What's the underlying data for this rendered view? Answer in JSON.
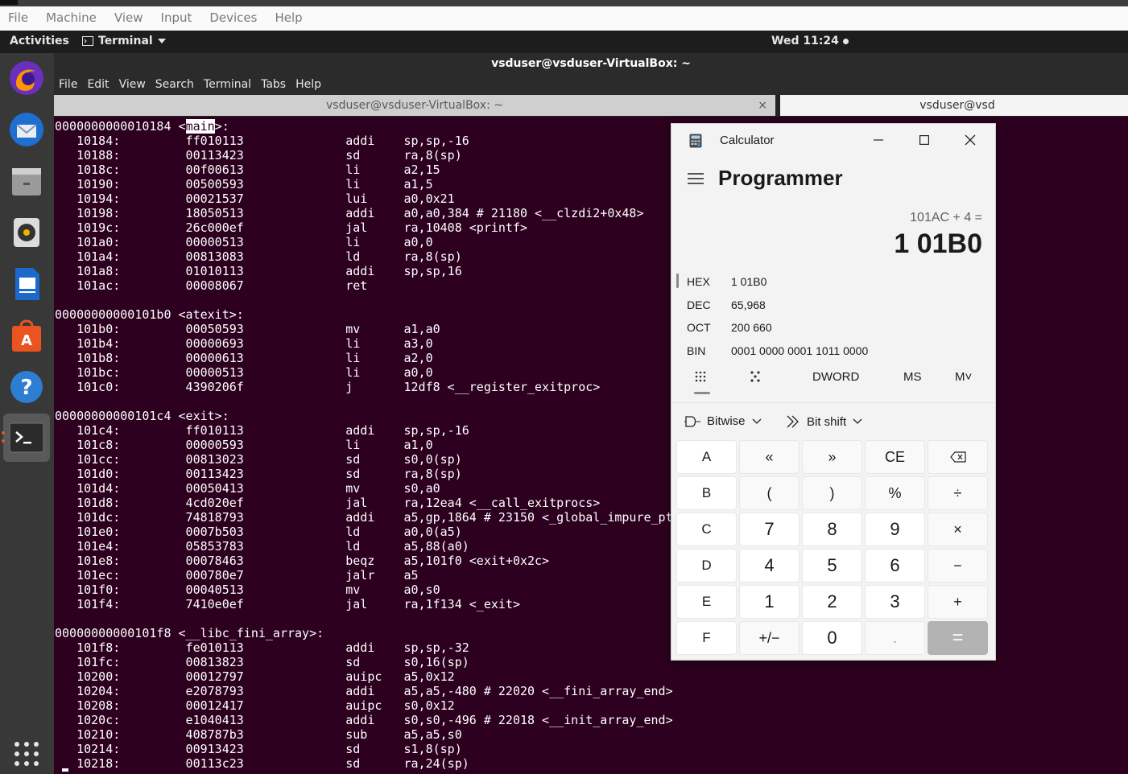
{
  "vbox_menu": [
    "File",
    "Machine",
    "View",
    "Input",
    "Devices",
    "Help"
  ],
  "topbar": {
    "activities": "Activities",
    "app_name": "Terminal",
    "clock": "Wed 11:24"
  },
  "terminal": {
    "window_title": "vsduser@vsduser-VirtualBox: ~",
    "menu": [
      "File",
      "Edit",
      "View",
      "Search",
      "Terminal",
      "Tabs",
      "Help"
    ],
    "tabs": [
      {
        "label": "vsduser@vsduser-VirtualBox: ~",
        "close": "×"
      },
      {
        "label": "vsduser@vsd"
      }
    ],
    "lines": [
      {
        "pre": "0000000000010184 <",
        "hl": "main",
        "post": ">:"
      },
      "   10184:\t  ff010113          \taddi\tsp,sp,-16",
      "   10188:\t  00113423          \tsd\tra,8(sp)",
      "   1018c:\t  00f00613          \tli\ta2,15",
      "   10190:\t  00500593          \tli\ta1,5",
      "   10194:\t  00021537          \tlui\ta0,0x21",
      "   10198:\t  18050513          \taddi\ta0,a0,384 # 21180 <__clzdi2+0x48>",
      "   1019c:\t  26c000ef          \tjal\tra,10408 <printf>",
      "   101a0:\t  00000513          \tli\ta0,0",
      "   101a4:\t  00813083          \tld\tra,8(sp)",
      "   101a8:\t  01010113          \taddi\tsp,sp,16",
      "   101ac:\t  00008067          \tret",
      "",
      "00000000000101b0 <atexit>:",
      "   101b0:\t  00050593          \tmv\ta1,a0",
      "   101b4:\t  00000693          \tli\ta3,0",
      "   101b8:\t  00000613          \tli\ta2,0",
      "   101bc:\t  00000513          \tli\ta0,0",
      "   101c0:\t  4390206f          \tj\t12df8 <__register_exitproc>",
      "",
      "00000000000101c4 <exit>:",
      "   101c4:\t  ff010113          \taddi\tsp,sp,-16",
      "   101c8:\t  00000593          \tli\ta1,0",
      "   101cc:\t  00813023          \tsd\ts0,0(sp)",
      "   101d0:\t  00113423          \tsd\tra,8(sp)",
      "   101d4:\t  00050413          \tmv\ts0,a0",
      "   101d8:\t  4cd020ef          \tjal\tra,12ea4 <__call_exitprocs>",
      "   101dc:\t  74818793          \taddi\ta5,gp,1864 # 23150 <_global_impure_ptr>",
      "   101e0:\t  0007b503          \tld\ta0,0(a5)",
      "   101e4:\t  05853783          \tld\ta5,88(a0)",
      "   101e8:\t  00078463          \tbeqz\ta5,101f0 <exit+0x2c>",
      "   101ec:\t  000780e7          \tjalr\ta5",
      "   101f0:\t  00040513          \tmv\ta0,s0",
      "   101f4:\t  7410e0ef          \tjal\tra,1f134 <_exit>",
      "",
      "00000000000101f8 <__libc_fini_array>:",
      "   101f8:\t  fe010113          \taddi\tsp,sp,-32",
      "   101fc:\t  00813823          \tsd\ts0,16(sp)",
      "   10200:\t  00012797          \tauipc\ta5,0x12",
      "   10204:\t  e2078793          \taddi\ta5,a5,-480 # 22020 <__fini_array_end>",
      "   10208:\t  00012417          \tauipc\ts0,0x12",
      "   1020c:\t  e1040413          \taddi\ts0,s0,-496 # 22018 <__init_array_end>",
      "   10210:\t  408787b3          \tsub\ta5,a5,s0",
      "   10214:\t  00913423          \tsd\ts1,8(sp)",
      "   10218:\t  00113c23          \tsd\tra,24(sp)"
    ]
  },
  "calculator": {
    "title": "Calculator",
    "mode": "Programmer",
    "expression": "101AC + 4 =",
    "result": "1 01B0",
    "radix": [
      {
        "label": "HEX",
        "value": "1 01B0"
      },
      {
        "label": "DEC",
        "value": "65,968"
      },
      {
        "label": "OCT",
        "value": "200 660"
      },
      {
        "label": "BIN",
        "value": "0001 0000 0001 1011 0000"
      }
    ],
    "word_size": "DWORD",
    "ms": "MS",
    "mplus": "M˅",
    "bitwise": "Bitwise",
    "bitshift": "Bit shift",
    "keys": [
      [
        "A",
        "«",
        "»",
        "CE",
        "⌫"
      ],
      [
        "B",
        "(",
        ")",
        "%",
        "÷"
      ],
      [
        "C",
        "7",
        "8",
        "9",
        "×"
      ],
      [
        "D",
        "4",
        "5",
        "6",
        "−"
      ],
      [
        "E",
        "1",
        "2",
        "3",
        "+"
      ],
      [
        "F",
        "+/−",
        "0",
        ".",
        "="
      ]
    ]
  },
  "colors": {
    "terminal_bg": "#2c001e",
    "dock_bg": "#383838",
    "topbar_bg": "#1d1d1d",
    "calc_bg": "#f3f3f3"
  }
}
